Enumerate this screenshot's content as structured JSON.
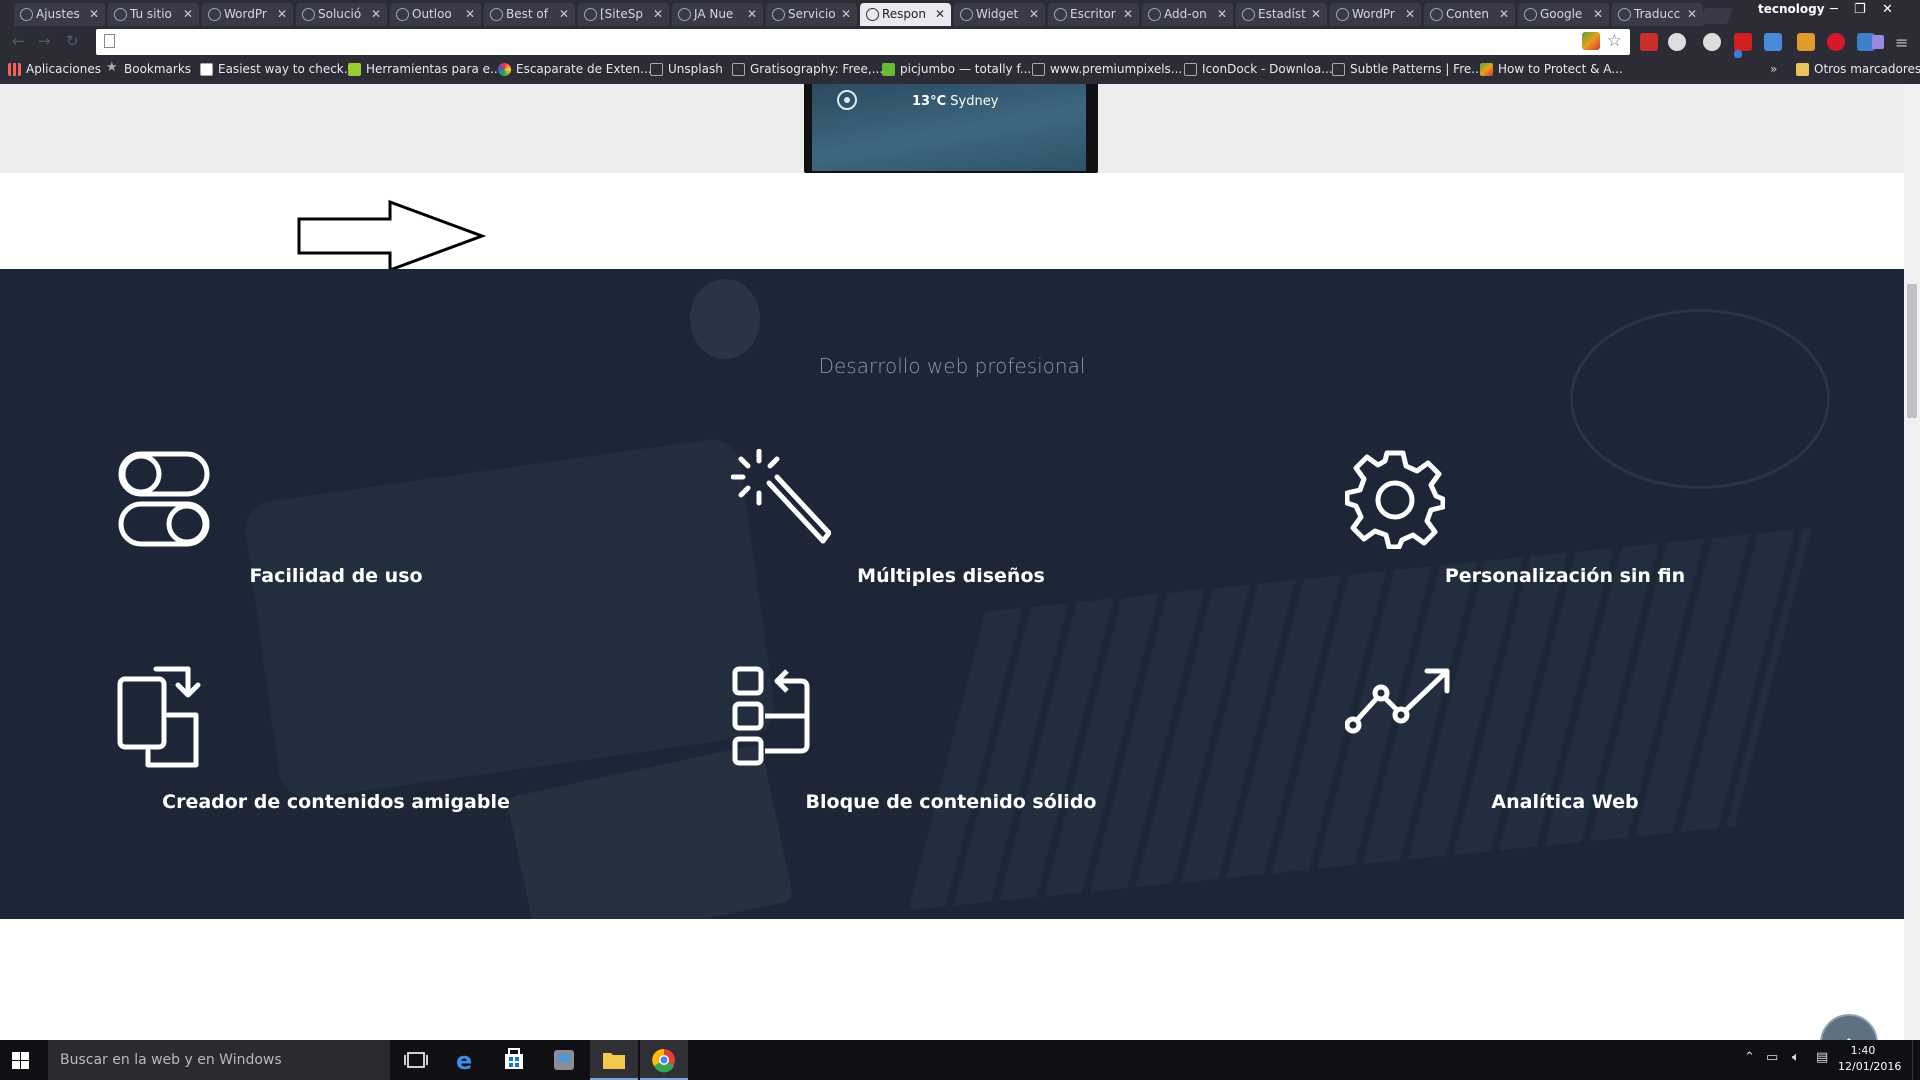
{
  "browser": {
    "tabs": [
      {
        "label": "Ajustes"
      },
      {
        "label": "Tu sitio"
      },
      {
        "label": "WordPr"
      },
      {
        "label": "Solució"
      },
      {
        "label": "Outloo"
      },
      {
        "label": "Best of"
      },
      {
        "label": "[SiteSp"
      },
      {
        "label": "JA Nue"
      },
      {
        "label": "Servicio"
      },
      {
        "label": "Respon",
        "active": true
      },
      {
        "label": "Widget"
      },
      {
        "label": "Escritor"
      },
      {
        "label": "Add-on"
      },
      {
        "label": "Estadíst"
      },
      {
        "label": "WordPr"
      },
      {
        "label": "Conten"
      },
      {
        "label": "Google"
      },
      {
        "label": "Traducc"
      }
    ],
    "profile_name": "tecnology",
    "address": ""
  },
  "bookmarks": {
    "apps_label": "Aplicaciones",
    "items": [
      {
        "label": "Bookmarks"
      },
      {
        "label": "Easiest way to check..."
      },
      {
        "label": "Herramientas para e..."
      },
      {
        "label": "Escaparate de Exten..."
      },
      {
        "label": "Unsplash"
      },
      {
        "label": "Gratisography: Free,..."
      },
      {
        "label": "picjumbo — totally f..."
      },
      {
        "label": "www.premiumpixels..."
      },
      {
        "label": "IconDock - Downloa..."
      },
      {
        "label": "Subtle Patterns | Fre..."
      },
      {
        "label": "How to Protect & A..."
      }
    ],
    "chevron": "»",
    "other_label": "Otros marcadores"
  },
  "page": {
    "weather": {
      "temp": "13°C",
      "city": "Sydney"
    },
    "section_title": "Desarrollo web profesional",
    "features": [
      {
        "label": "Facilidad de uso",
        "icon": "toggle-icon"
      },
      {
        "label": "Múltiples diseños",
        "icon": "magic-wand-icon"
      },
      {
        "label": "Personalización sin fin",
        "icon": "gear-icon"
      },
      {
        "label": "Creador de contenidos amigable",
        "icon": "devices-sync-icon"
      },
      {
        "label": "Bloque de contenido sólido",
        "icon": "content-blocks-icon"
      },
      {
        "label": "Analítica Web",
        "icon": "analytics-icon"
      }
    ]
  },
  "taskbar": {
    "search_placeholder": "Buscar en la web y en Windows",
    "time": "1:40",
    "date": "12/01/2016"
  },
  "colors": {
    "dark_section_bg": "#1c2636",
    "browser_chrome": "#2c2c36",
    "feature_text": "#ffffff",
    "section_title": "#8d95a2",
    "back_to_top": "#5f7181"
  }
}
